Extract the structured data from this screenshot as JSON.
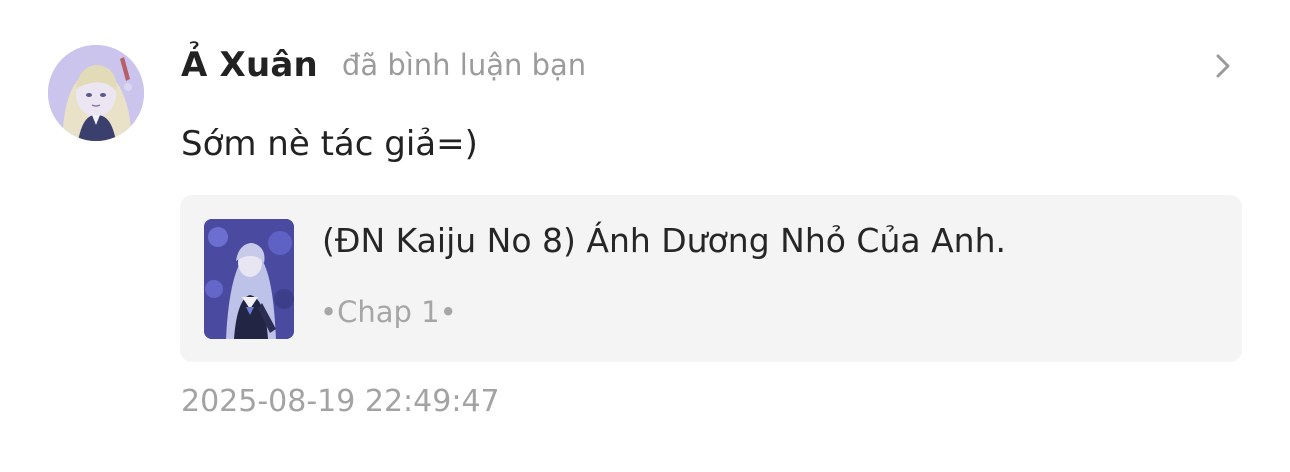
{
  "notification": {
    "user": {
      "name": "Ả Xuân",
      "avatar_icon": "user-avatar-illustration"
    },
    "action": "đã bình luận bạn",
    "comment": "Sớm nè tác giả=)",
    "story": {
      "title": "(ĐN Kaiju No 8) Ánh Dương Nhỏ Của Anh.",
      "chapter": "•Chap 1•",
      "cover_icon": "story-cover-illustration"
    },
    "timestamp": "2025-08-19 22:49:47",
    "chevron_icon": "chevron-right-icon"
  },
  "colors": {
    "name": "#222222",
    "secondary_text": "#9b9b9b",
    "card_background": "#f4f4f5",
    "avatar_tint": "#c9c3ec",
    "cover_tint": "#3e3b8e"
  }
}
